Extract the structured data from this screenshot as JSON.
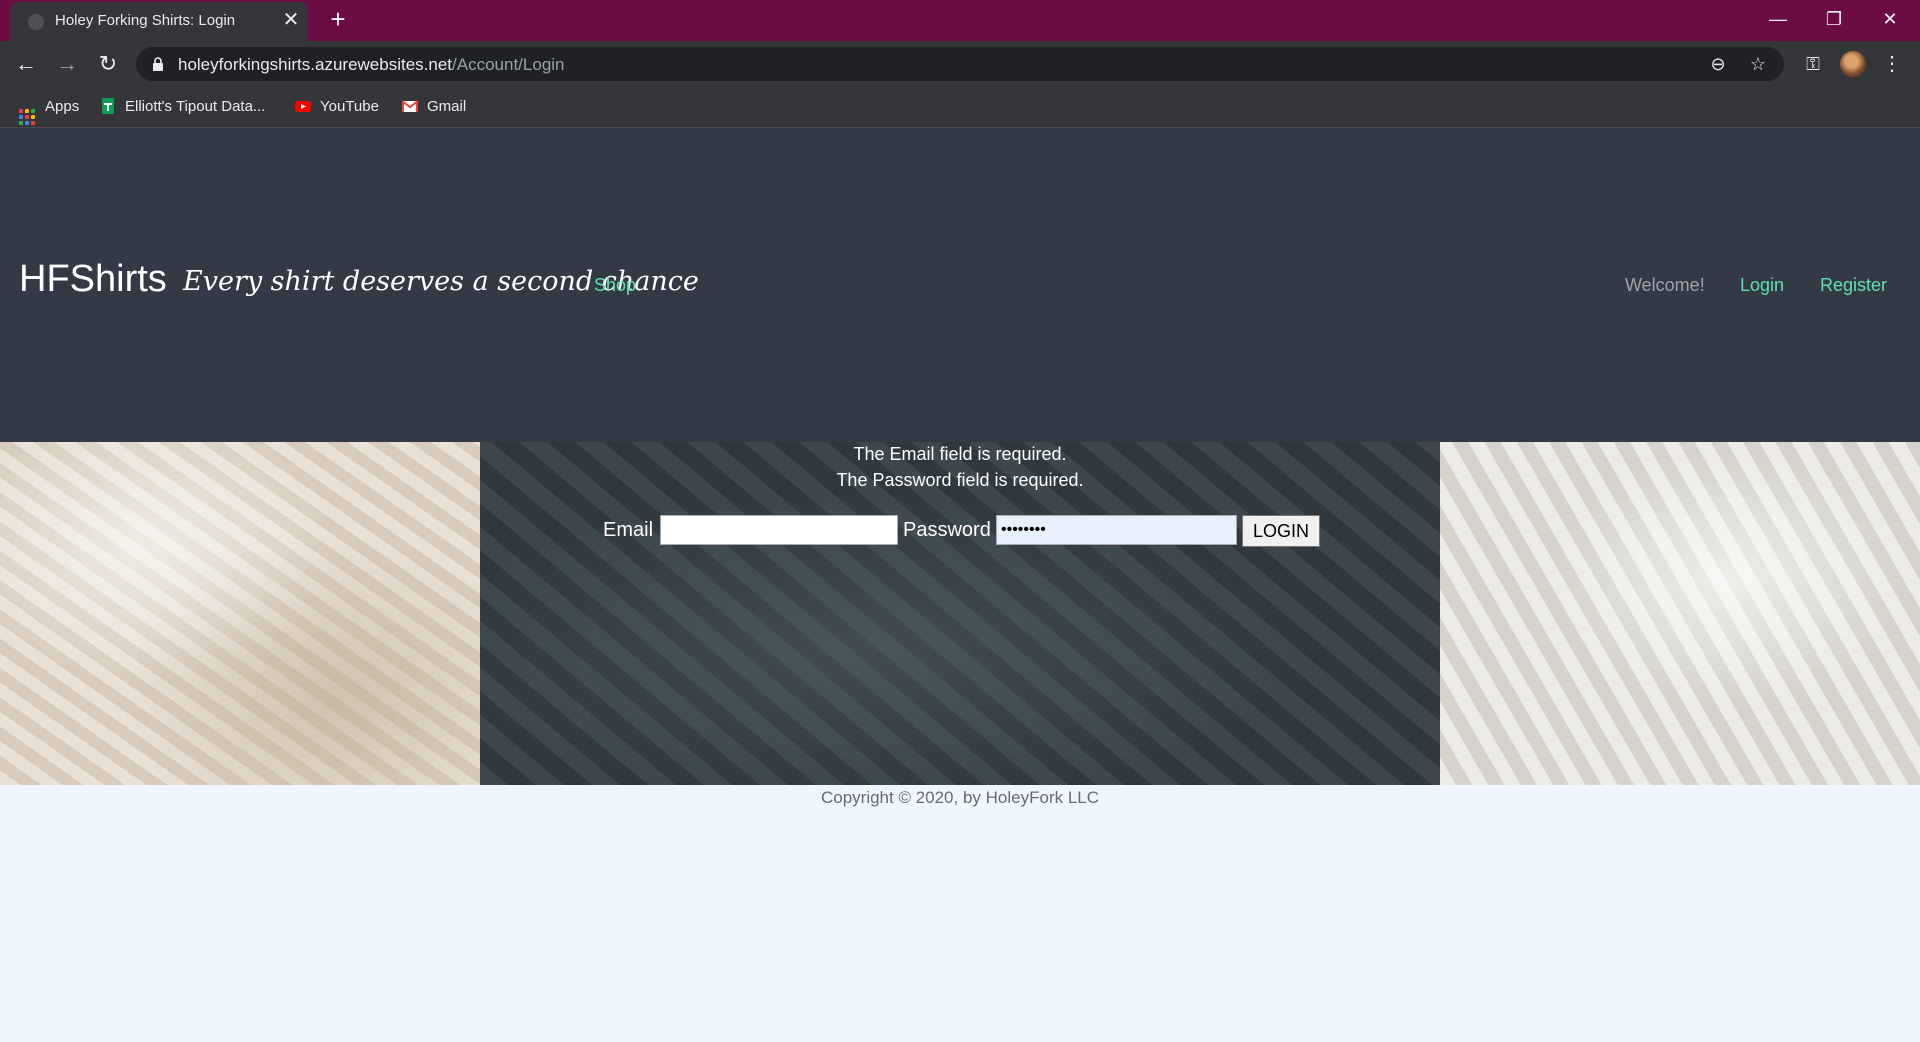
{
  "browser": {
    "tab_title": "Holey Forking Shirts: Login",
    "url_host": "holeyforkingshirts.azurewebsites.net",
    "url_path": "/Account/Login",
    "bookmarks": [
      {
        "label": "Apps",
        "icon": "apps-grid-icon"
      },
      {
        "label": "Elliott's Tipout Data...",
        "icon": "sheets-icon"
      },
      {
        "label": "YouTube",
        "icon": "youtube-icon"
      },
      {
        "label": "Gmail",
        "icon": "gmail-icon"
      }
    ],
    "colors": {
      "tab_strip": "#6b0d43",
      "toolbar": "#35363a"
    }
  },
  "header": {
    "brand": "HFShirts",
    "tagline": "Every shirt deserves a second chance",
    "nav": {
      "shop": "Shop",
      "welcome": "Welcome!",
      "login": "Login",
      "register": "Register"
    },
    "colors": {
      "background": "#343a45",
      "link": "#5ee0b5"
    }
  },
  "login_form": {
    "errors": {
      "email": "The Email field is required.",
      "password": "The Password field is required."
    },
    "email_label": "Email",
    "email_value": "",
    "password_label": "Password",
    "password_value": "••••••••",
    "submit_label": "LOGIN"
  },
  "footer": {
    "copyright": "Copyright © 2020, by HoleyFork LLC"
  }
}
